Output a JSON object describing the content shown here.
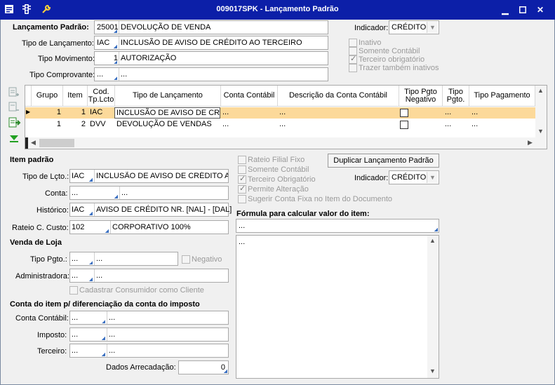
{
  "window": {
    "title": "009017SPK - Lançamento Padrão"
  },
  "header": {
    "lancamento_padrao_label": "Lançamento Padrão:",
    "lancamento_padrao_code": "25001",
    "lancamento_padrao_desc": "DEVOLUÇÃO DE VENDA",
    "tipo_lancamento_label": "Tipo de Lançamento:",
    "tipo_lancamento_code": "IAC",
    "tipo_lancamento_desc": "INCLUSÃO DE AVISO DE CRÉDITO AO TERCEIRO",
    "tipo_movimento_label": "Tipo Movimento:",
    "tipo_movimento_code": "1",
    "tipo_movimento_desc": "AUTORIZAÇÃO",
    "tipo_comprovante_label": "Tipo Comprovante:",
    "tipo_comprovante_code": "...",
    "tipo_comprovante_desc": "...",
    "indicador_label": "Indicador:",
    "indicador_value": "CRÉDITO",
    "checks": {
      "inativo": "Inativo",
      "somente_contabil": "Somente Contábil",
      "terceiro_obrigatorio": "Terceiro obrigatório",
      "trazer_inativos": "Trazer também inativos"
    }
  },
  "grid": {
    "columns": {
      "grupo": "Grupo",
      "item": "Item",
      "cod_tp_lcto_1": "Cod.",
      "cod_tp_lcto_2": "Tp.Lcto",
      "tipo_lancamento": "Tipo de Lançamento",
      "conta_contabil": "Conta Contábil",
      "descricao_conta": "Descrição da Conta Contábil",
      "tipo_pgto_negativo_1": "Tipo Pgto",
      "tipo_pgto_negativo_2": "Negativo",
      "tipo_pgto_1": "Tipo",
      "tipo_pgto_2": "Pgto.",
      "tipo_pagamento": "Tipo Pagamento"
    },
    "rows": [
      {
        "grupo": "1",
        "item": "1",
        "cod": "IAC",
        "tipo": "INCLUSÃO DE AVISO DE CRÉD",
        "conta": "...",
        "descricao": "...",
        "tipo_pgto": "...",
        "tipo_pagamento": "..."
      },
      {
        "grupo": "1",
        "item": "2",
        "cod": "DVV",
        "tipo": "DEVOLUÇÃO DE VENDAS",
        "conta": "...",
        "descricao": "...",
        "tipo_pgto": "...",
        "tipo_pagamento": "..."
      }
    ]
  },
  "item_padrao": {
    "section_title": "Item padrão",
    "tipo_lcto_label": "Tipo de Lçto.:",
    "tipo_lcto_code": "IAC",
    "tipo_lcto_desc": "INCLUSÃO DE AVISO DE CRÉDITO AO T",
    "conta_label": "Conta:",
    "conta_code": "...",
    "conta_desc": "...",
    "historico_label": "Histórico:",
    "historico_code": "IAC",
    "historico_desc": "AVISO DE CRÉDITO NR. [NAL] - [DAL]",
    "rateio_label": "Rateio C. Custo:",
    "rateio_code": "102",
    "rateio_desc": "CORPORATIVO 100%",
    "checks": {
      "rateio_filial_fixo": "Rateio Filial Fixo",
      "somente_contabil": "Somente Contábil",
      "terceiro_obrigatorio": "Terceiro Obrigatório",
      "permite_alteracao": "Permite Alteração",
      "sugerir_conta_fixa": "Sugerir Conta Fixa no Item do Documento"
    },
    "duplicar_button": "Duplicar Lançamento Padrão",
    "indicador_label": "Indicador:",
    "indicador_value": "CRÉDITO"
  },
  "venda_loja": {
    "section_title": "Venda de Loja",
    "tipo_pgto_label": "Tipo Pgto.:",
    "tipo_pgto_code": "...",
    "tipo_pgto_desc": "...",
    "negativo": "Negativo",
    "administradora_label": "Administradora:",
    "administradora_code": "...",
    "administradora_desc": "...",
    "cadastrar_consumidor": "Cadastrar Consumidor como Cliente"
  },
  "conta_item": {
    "section_title": "Conta do item p/ diferenciação da conta do imposto",
    "conta_contabil_label": "Conta Contábil:",
    "conta_contabil_code": "...",
    "conta_contabil_desc": "...",
    "imposto_label": "Imposto:",
    "imposto_code": "...",
    "imposto_desc": "...",
    "terceiro_label": "Terceiro:",
    "terceiro_code": "...",
    "terceiro_desc": "...",
    "dados_arrecadacao_label": "Dados Arrecadação:",
    "dados_arrecadacao_value": "0"
  },
  "formula": {
    "label": "Fórmula para calcular valor do item:",
    "value": "...",
    "memo": "..."
  }
}
